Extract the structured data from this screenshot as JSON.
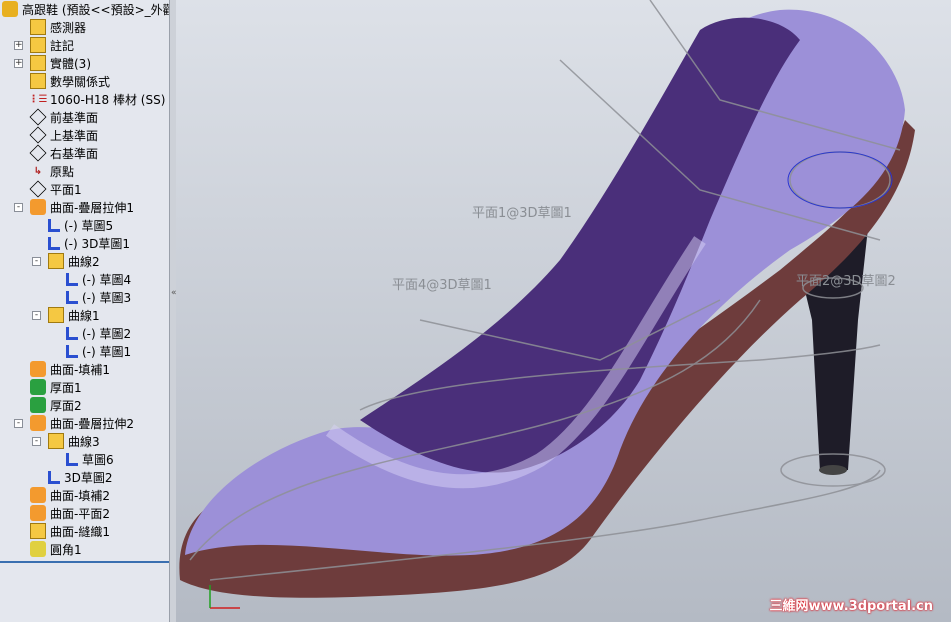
{
  "tree": {
    "root": "高跟鞋 (預設<<預設>_外觀",
    "items": [
      {
        "label": "感測器",
        "icon": "sensor-folder-icon",
        "level": 1
      },
      {
        "label": "註記",
        "icon": "annotation-folder-icon",
        "level": 1,
        "expand": "+"
      },
      {
        "label": "實體(3)",
        "icon": "solid-bodies-folder-icon",
        "level": 1,
        "expand": "+"
      },
      {
        "label": "數學關係式",
        "icon": "equations-folder-icon",
        "level": 1
      },
      {
        "label": "1060-H18 棒材 (SS)",
        "icon": "material-icon",
        "level": 1
      },
      {
        "label": "前基準面",
        "icon": "plane-icon",
        "level": 1
      },
      {
        "label": "上基準面",
        "icon": "plane-icon",
        "level": 1
      },
      {
        "label": "右基準面",
        "icon": "plane-icon",
        "level": 1
      },
      {
        "label": "原點",
        "icon": "origin-icon",
        "level": 1
      },
      {
        "label": "平面1",
        "icon": "plane-icon",
        "level": 1
      },
      {
        "label": "曲面-疊層拉伸1",
        "icon": "loft-surface-icon",
        "level": 1,
        "expand": "-"
      },
      {
        "label": "(-) 草圖5",
        "icon": "sketch-icon",
        "level": 2
      },
      {
        "label": "(-) 3D草圖1",
        "icon": "3d-sketch-icon",
        "level": 2
      },
      {
        "label": "曲線2",
        "icon": "curve-icon",
        "level": 2,
        "expand": "-"
      },
      {
        "label": "(-) 草圖4",
        "icon": "sketch-icon",
        "level": 3
      },
      {
        "label": "(-) 草圖3",
        "icon": "sketch-icon",
        "level": 3
      },
      {
        "label": "曲線1",
        "icon": "curve-icon",
        "level": 2,
        "expand": "-"
      },
      {
        "label": "(-) 草圖2",
        "icon": "sketch-icon",
        "level": 3
      },
      {
        "label": "(-) 草圖1",
        "icon": "sketch-icon",
        "level": 3
      },
      {
        "label": "曲面-填補1",
        "icon": "fill-surface-icon",
        "level": 1
      },
      {
        "label": "厚面1",
        "icon": "thicken-icon",
        "level": 1
      },
      {
        "label": "厚面2",
        "icon": "thicken-icon",
        "level": 1
      },
      {
        "label": "曲面-疊層拉伸2",
        "icon": "loft-surface-icon",
        "level": 1,
        "expand": "-"
      },
      {
        "label": "曲線3",
        "icon": "curve-icon",
        "level": 2,
        "expand": "-"
      },
      {
        "label": "草圖6",
        "icon": "sketch-icon",
        "level": 3
      },
      {
        "label": "3D草圖2",
        "icon": "3d-sketch-icon",
        "level": 2
      },
      {
        "label": "曲面-填補2",
        "icon": "fill-surface-icon",
        "level": 1
      },
      {
        "label": "曲面-平面2",
        "icon": "planar-surface-icon",
        "level": 1
      },
      {
        "label": "曲面-縫織1",
        "icon": "knit-surface-icon",
        "level": 1
      },
      {
        "label": "圓角1",
        "icon": "fillet-icon",
        "level": 1
      }
    ]
  },
  "viewport": {
    "labels": [
      "平面1@3D草圖1",
      "平面4@3D草圖1",
      "平面2@3D草圖2"
    ],
    "watermark": "三維网www.3dportal.cn",
    "colors": {
      "upper": "#8f7fd0",
      "sole": "#6a3a3a",
      "heel": "#1e1c28",
      "lining": "#4a2f7a"
    }
  }
}
